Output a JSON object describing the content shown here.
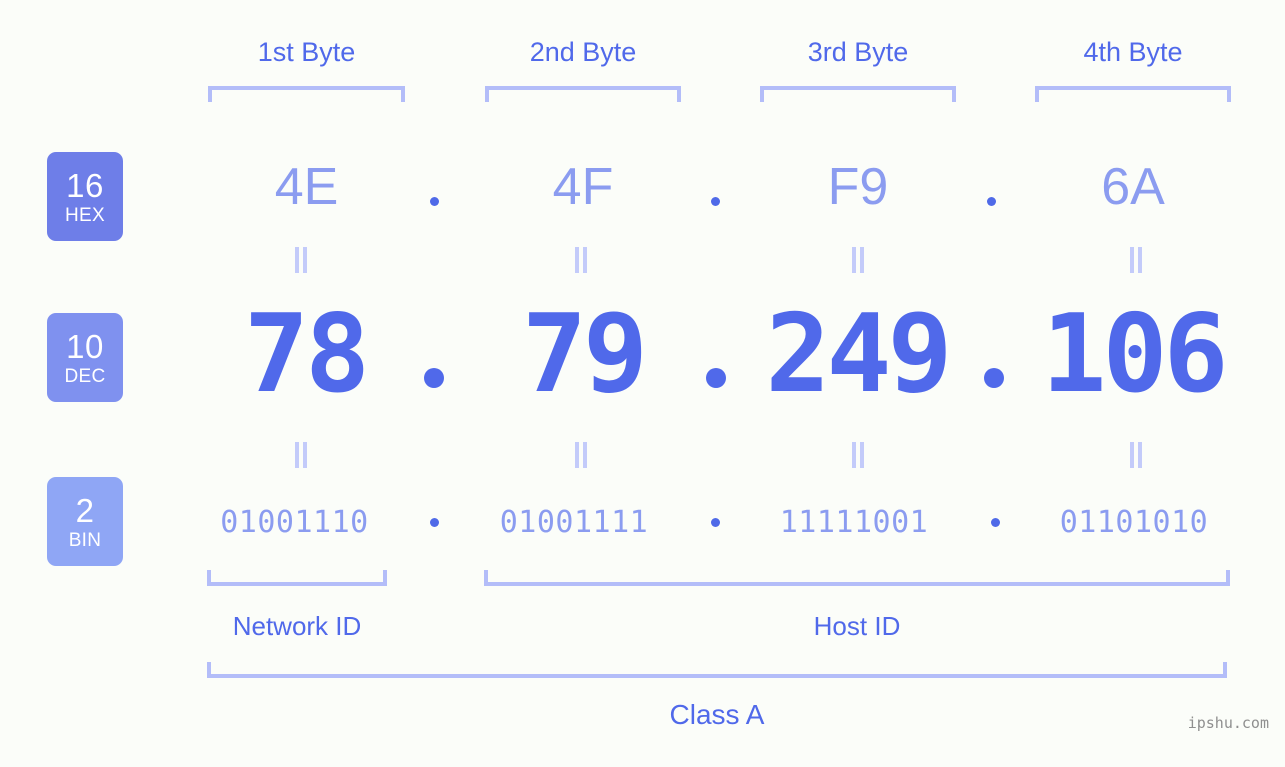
{
  "meta": {
    "background_color": "#fbfdf9",
    "accent_color": "#5069ea",
    "light_accent_color": "#8b9cf0",
    "bracket_color": "#b3bdf9"
  },
  "byte_headers": [
    {
      "label": "1st Byte"
    },
    {
      "label": "2nd Byte"
    },
    {
      "label": "3rd Byte"
    },
    {
      "label": "4th Byte"
    }
  ],
  "rows": {
    "hex": {
      "badge_number": "16",
      "badge_system": "HEX",
      "badge_color": "#6e7ee8",
      "values": [
        "4E",
        "4F",
        "F9",
        "6A"
      ],
      "separator": "."
    },
    "dec": {
      "badge_number": "10",
      "badge_system": "DEC",
      "badge_color": "#7f91ef",
      "values": [
        "78",
        "79",
        "249",
        "106"
      ],
      "separator": "."
    },
    "bin": {
      "badge_number": "2",
      "badge_system": "BIN",
      "badge_color": "#8fa6f5",
      "values": [
        "01001110",
        "01001111",
        "11111001",
        "01101010"
      ],
      "separator": "."
    }
  },
  "equals_marks": {
    "glyph": "ǁ",
    "count_per_row": 4
  },
  "id_sections": [
    {
      "label": "Network ID"
    },
    {
      "label": "Host ID"
    }
  ],
  "class": {
    "label": "Class A"
  },
  "watermark": {
    "text": "ipshu.com"
  }
}
